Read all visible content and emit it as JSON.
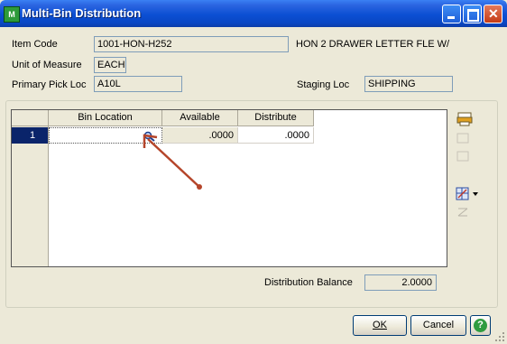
{
  "window": {
    "title": "Multi-Bin Distribution",
    "app_icon_text": "M"
  },
  "form": {
    "item_code_label": "Item Code",
    "item_code_value": "1001-HON-H252",
    "item_description": "HON 2 DRAWER LETTER FLE W/",
    "uom_label": "Unit of Measure",
    "uom_value": "EACH",
    "pick_loc_label": "Primary Pick Loc",
    "pick_loc_value": "A10L",
    "staging_label": "Staging Loc",
    "staging_value": "SHIPPING"
  },
  "grid": {
    "columns": [
      "Bin Location",
      "Available",
      "Distribute"
    ],
    "rows": [
      {
        "num": "1",
        "bin": "",
        "available": ".0000",
        "distribute": ".0000"
      }
    ]
  },
  "balance": {
    "label": "Distribution Balance",
    "value": "2.0000"
  },
  "buttons": {
    "ok": "OK",
    "cancel": "Cancel"
  },
  "annotation": {
    "arrow_color": "#b5452a"
  }
}
